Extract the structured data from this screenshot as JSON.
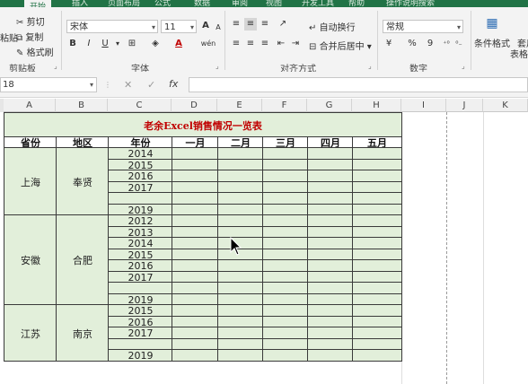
{
  "ribbon_tabs": [
    "开始",
    "插入",
    "页面布局",
    "公式",
    "数据",
    "审阅",
    "视图",
    "开发工具",
    "帮助",
    "操作说明搜索"
  ],
  "ribbon": {
    "clipboard": {
      "cut": "剪切",
      "copy": "复制",
      "format_painter": "格式刷",
      "paste": "粘贴",
      "group": "剪贴板"
    },
    "font": {
      "name": "宋体",
      "size": "11",
      "bold": "B",
      "italic": "I",
      "underline": "U",
      "grow": "A",
      "shrink": "A",
      "font_color": "A",
      "wen": "wén",
      "group": "字体"
    },
    "alignment": {
      "wrap_text": "自动换行",
      "merge_center": "合并后居中",
      "group": "对齐方式"
    },
    "number": {
      "format": "常规",
      "percent": "%",
      "comma": "9",
      "group": "数字"
    },
    "styles": {
      "conditional": "条件格式",
      "table_format": "套用",
      "table_format2": "表格格式"
    }
  },
  "formula_bar": {
    "name_box": "18",
    "fx": "fx",
    "cancel": "✕",
    "enter": "✓",
    "content": ""
  },
  "columns": [
    "A",
    "B",
    "C",
    "D",
    "E",
    "F",
    "G",
    "H",
    "I",
    "J",
    "K"
  ],
  "sheet": {
    "title": "老余Excel销售情况一览表",
    "headers": [
      "省份",
      "地区",
      "年份",
      "一月",
      "二月",
      "三月",
      "四月",
      "五月"
    ],
    "groups": [
      {
        "province": "上海",
        "region": "奉贤",
        "years": [
          "2014",
          "2015",
          "2016",
          "2017",
          "",
          "2019"
        ]
      },
      {
        "province": "安徽",
        "region": "合肥",
        "years": [
          "2012",
          "2013",
          "2014",
          "2015",
          "2016",
          "2017",
          "",
          "2019"
        ]
      },
      {
        "province": "江苏",
        "region": "南京",
        "years": [
          "2015",
          "2016",
          "2017",
          "",
          "2019"
        ]
      }
    ]
  }
}
